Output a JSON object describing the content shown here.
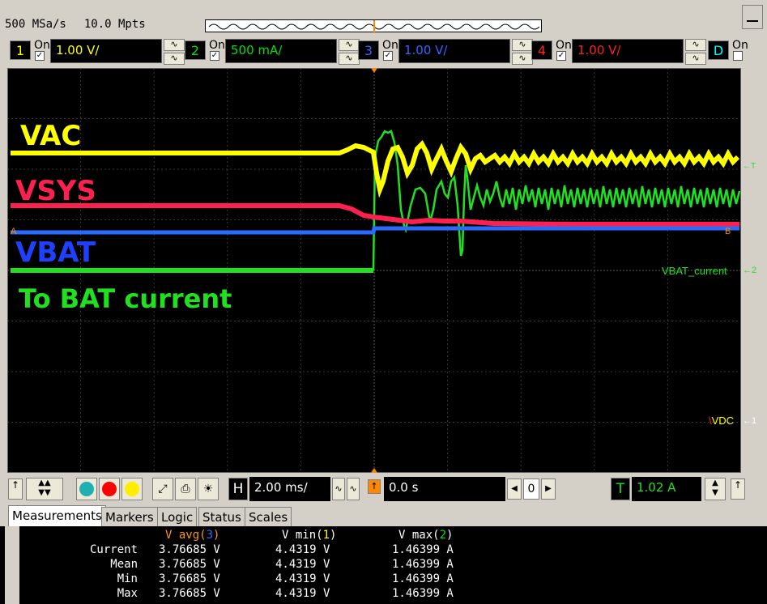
{
  "top": {
    "sample_rate": "500 MSa/s",
    "memory_depth": "10.0 Mpts"
  },
  "channels": [
    {
      "num": "1",
      "on_label": "On",
      "scale": "1.00 V/",
      "color": "#ffff00"
    },
    {
      "num": "2",
      "on_label": "On",
      "scale": "500 mA/",
      "color": "#00e000"
    },
    {
      "num": "3",
      "on_label": "On",
      "scale": "1.00 V/",
      "color": "#3366ff"
    },
    {
      "num": "4",
      "on_label": "On",
      "scale": "1.00 V/",
      "color": "#ff2020"
    }
  ],
  "digital": {
    "label": "D",
    "on_label": "On",
    "color": "#00ffff"
  },
  "annotations": {
    "vac": "VAC",
    "vsys": "VSYS",
    "vbat": "VBAT",
    "current": "To BAT current"
  },
  "markers": {
    "trigger_right": "T",
    "ref_a": "A",
    "ref_b": "B",
    "vbat_current": "VBAT_current",
    "ch2_marker": "2",
    "vdc": "VDC",
    "ch1_marker": "1"
  },
  "controls": {
    "timebase": "2.00 ms/",
    "delay": "0.0 s",
    "zero": "0",
    "trigger_level": "1.02 A",
    "h_label": "H",
    "t_label": "T"
  },
  "tabs": [
    "Measurements",
    "Markers",
    "Logic",
    "Status",
    "Scales"
  ],
  "measurements": {
    "headers": [
      {
        "name": "V avg",
        "src": "3",
        "color": "#ff9900",
        "src_color": "#3366ff"
      },
      {
        "name": "V min",
        "src": "1",
        "color": "#ffffff",
        "src_color": "#ffff00"
      },
      {
        "name": "V max",
        "src": "2",
        "color": "#ffffff",
        "src_color": "#00e000"
      }
    ],
    "rows": [
      {
        "label": "Current",
        "values": [
          "3.76685 V",
          "4.4319 V",
          "1.46399 A"
        ]
      },
      {
        "label": "Mean",
        "values": [
          "3.76685 V",
          "4.4319 V",
          "1.46399 A"
        ]
      },
      {
        "label": "Min",
        "values": [
          "3.76685 V",
          "4.4319 V",
          "1.46399 A"
        ]
      },
      {
        "label": "Max",
        "values": [
          "3.76685 V",
          "4.4319 V",
          "1.46399 A"
        ]
      }
    ]
  }
}
